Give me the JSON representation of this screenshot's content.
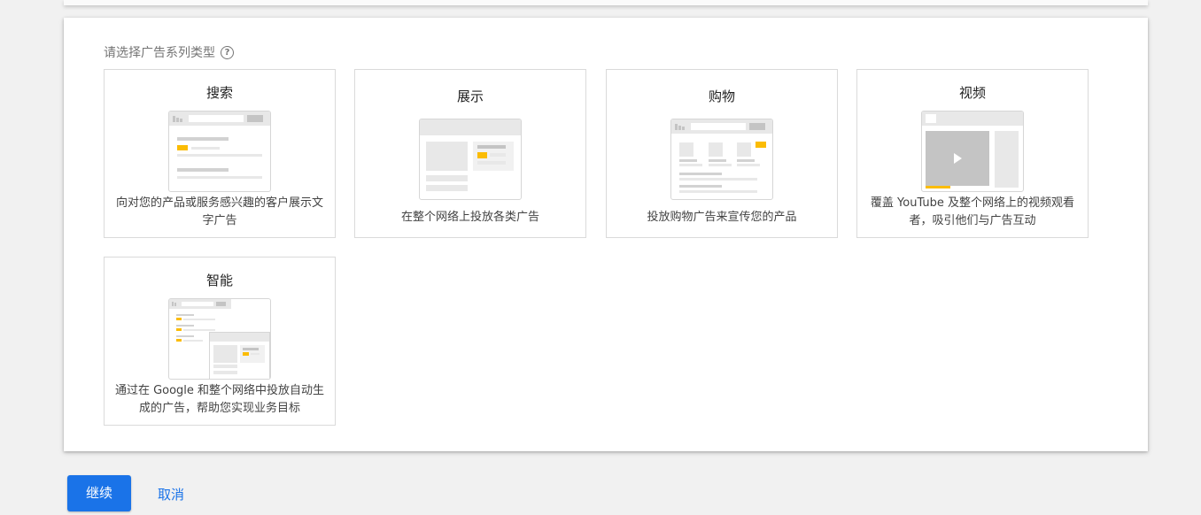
{
  "section_label": "请选择广告系列类型",
  "help_glyph": "?",
  "campaign_types": [
    {
      "title": "搜索",
      "description": "向对您的产品或服务感兴趣的客户展示文字广告"
    },
    {
      "title": "展示",
      "description": "在整个网络上投放各类广告"
    },
    {
      "title": "购物",
      "description": "投放购物广告来宣传您的产品"
    },
    {
      "title": "视频",
      "description": "覆盖 YouTube 及整个网络上的视频观看者，吸引他们与广告互动"
    },
    {
      "title": "智能",
      "description": "通过在 Google 和整个网络中投放自动生成的广告，帮助您实现业务目标"
    }
  ],
  "buttons": {
    "continue": "继续",
    "cancel": "取消"
  },
  "colors": {
    "accent": "#1a73e8",
    "highlight": "#fbbc04",
    "border": "#dadada"
  }
}
